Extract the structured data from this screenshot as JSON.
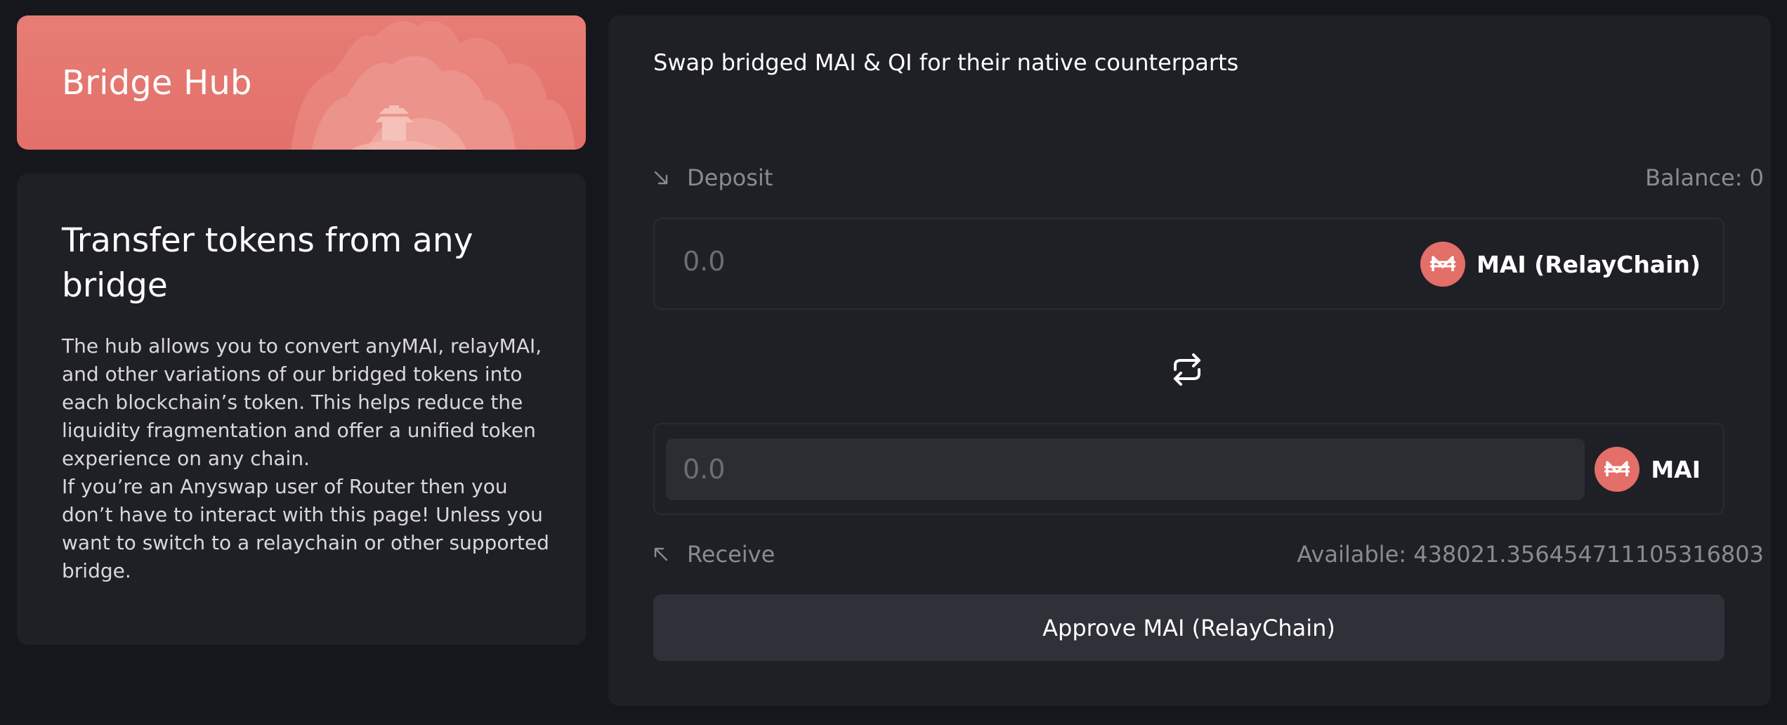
{
  "hero": {
    "title": "Bridge Hub"
  },
  "info": {
    "title": "Transfer tokens from any bridge",
    "paragraph1": "The hub allows you to convert anyMAI, relayMAI, and other variations of our bridged tokens into each blockchain’s token. This helps reduce the liquidity fragmentation and offer a unified token experience on any chain.",
    "paragraph2": "If you’re an Anyswap user of Router then you don’t have to interact with this page! Unless you want to switch to a relaychain or other supported bridge."
  },
  "swap": {
    "subtitle": "Swap bridged MAI & QI for their native counterparts",
    "deposit": {
      "label": "Deposit",
      "balance": "Balance: 0",
      "amount": "0.0",
      "token": "MAI (RelayChain)",
      "icon": "mai-token-icon"
    },
    "toggle_icon": "swap-arrows-icon",
    "receive": {
      "label": "Receive",
      "available": "Available: 438021.356454711105316803",
      "amount": "0.0",
      "token": "MAI",
      "icon": "mai-token-icon"
    },
    "approve_label": "Approve MAI (RelayChain)"
  },
  "colors": {
    "background": "#16171c",
    "card": "#1f2025",
    "accent": "#e46e68",
    "muted_text": "#8a8b92",
    "button": "#2f3038"
  }
}
